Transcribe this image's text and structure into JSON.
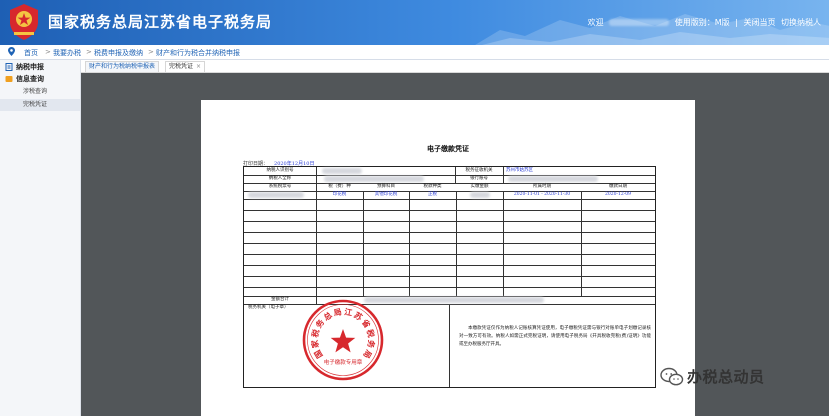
{
  "header": {
    "title": "国家税务总局江苏省电子税务局",
    "welcome": "欢迎",
    "use_version": "使用版别：M版",
    "close_page": "关闭当页",
    "switch_user": "切换纳税人"
  },
  "breadcrumb": [
    "首页",
    "我要办税",
    "税费申报及缴纳",
    "财产和行为税合并纳税申报"
  ],
  "sidebar": {
    "items": [
      {
        "label": "纳税申报"
      },
      {
        "label": "信息查询"
      },
      {
        "label": "涉税查询"
      },
      {
        "label": "完税凭证"
      }
    ]
  },
  "tabs": [
    {
      "label": "财产和行为税纳税申报表"
    },
    {
      "label": "完税凭证"
    }
  ],
  "tab_close_glyph": "×",
  "document": {
    "title": "电子缴款凭证",
    "print_date_label": "打印日期：",
    "print_date": "2020年12月10日",
    "labels": {
      "taxpayer_id": "纳税人识别号",
      "taxpayer_name": "纳税人全称",
      "tax_authority": "税务征收机关",
      "bank_account": "银行账号",
      "voucher_no": "系统税票号",
      "tax_type": "税（费）种",
      "budget_item": "预算科目",
      "tax_item": "税款种类",
      "amount": "实缴金额",
      "period": "所属时期",
      "pay_date": "缴款日期",
      "total": "金额合计",
      "authority_stamp": "税务机关（电子章）"
    },
    "tax_authority_value": "苏州市姑苏区",
    "row": {
      "tax_type": "印花税",
      "budget_item": "其他印花税",
      "tax_item": "正税",
      "period": "2020-11-01 - 2020-11-30",
      "pay_date": "2020-12-09"
    },
    "seal": {
      "text": "国家税务总局江苏省税务局",
      "bottom": "电子缴款专用章"
    },
    "note": "本缴款凭证仅作为纳税人记账核算凭证使用，电子缴税凭证需与银行对账单电子划缴记录核对一致方可有效。纳税人如需正式完税证明，请使用电子税务局《开具税收完税(费)证明》功能或至办税服务厅开具。"
  },
  "watermark": {
    "text": "办税总动员"
  },
  "colors": {
    "header_blue": "#1e5fb4",
    "seal_red": "#d7282d",
    "link_blue": "#1f63b5",
    "viewer_gray": "#525659"
  },
  "icons": [
    "emblem-icon",
    "location-pin-icon",
    "doc-icon",
    "info-icon",
    "wechat-icon"
  ]
}
